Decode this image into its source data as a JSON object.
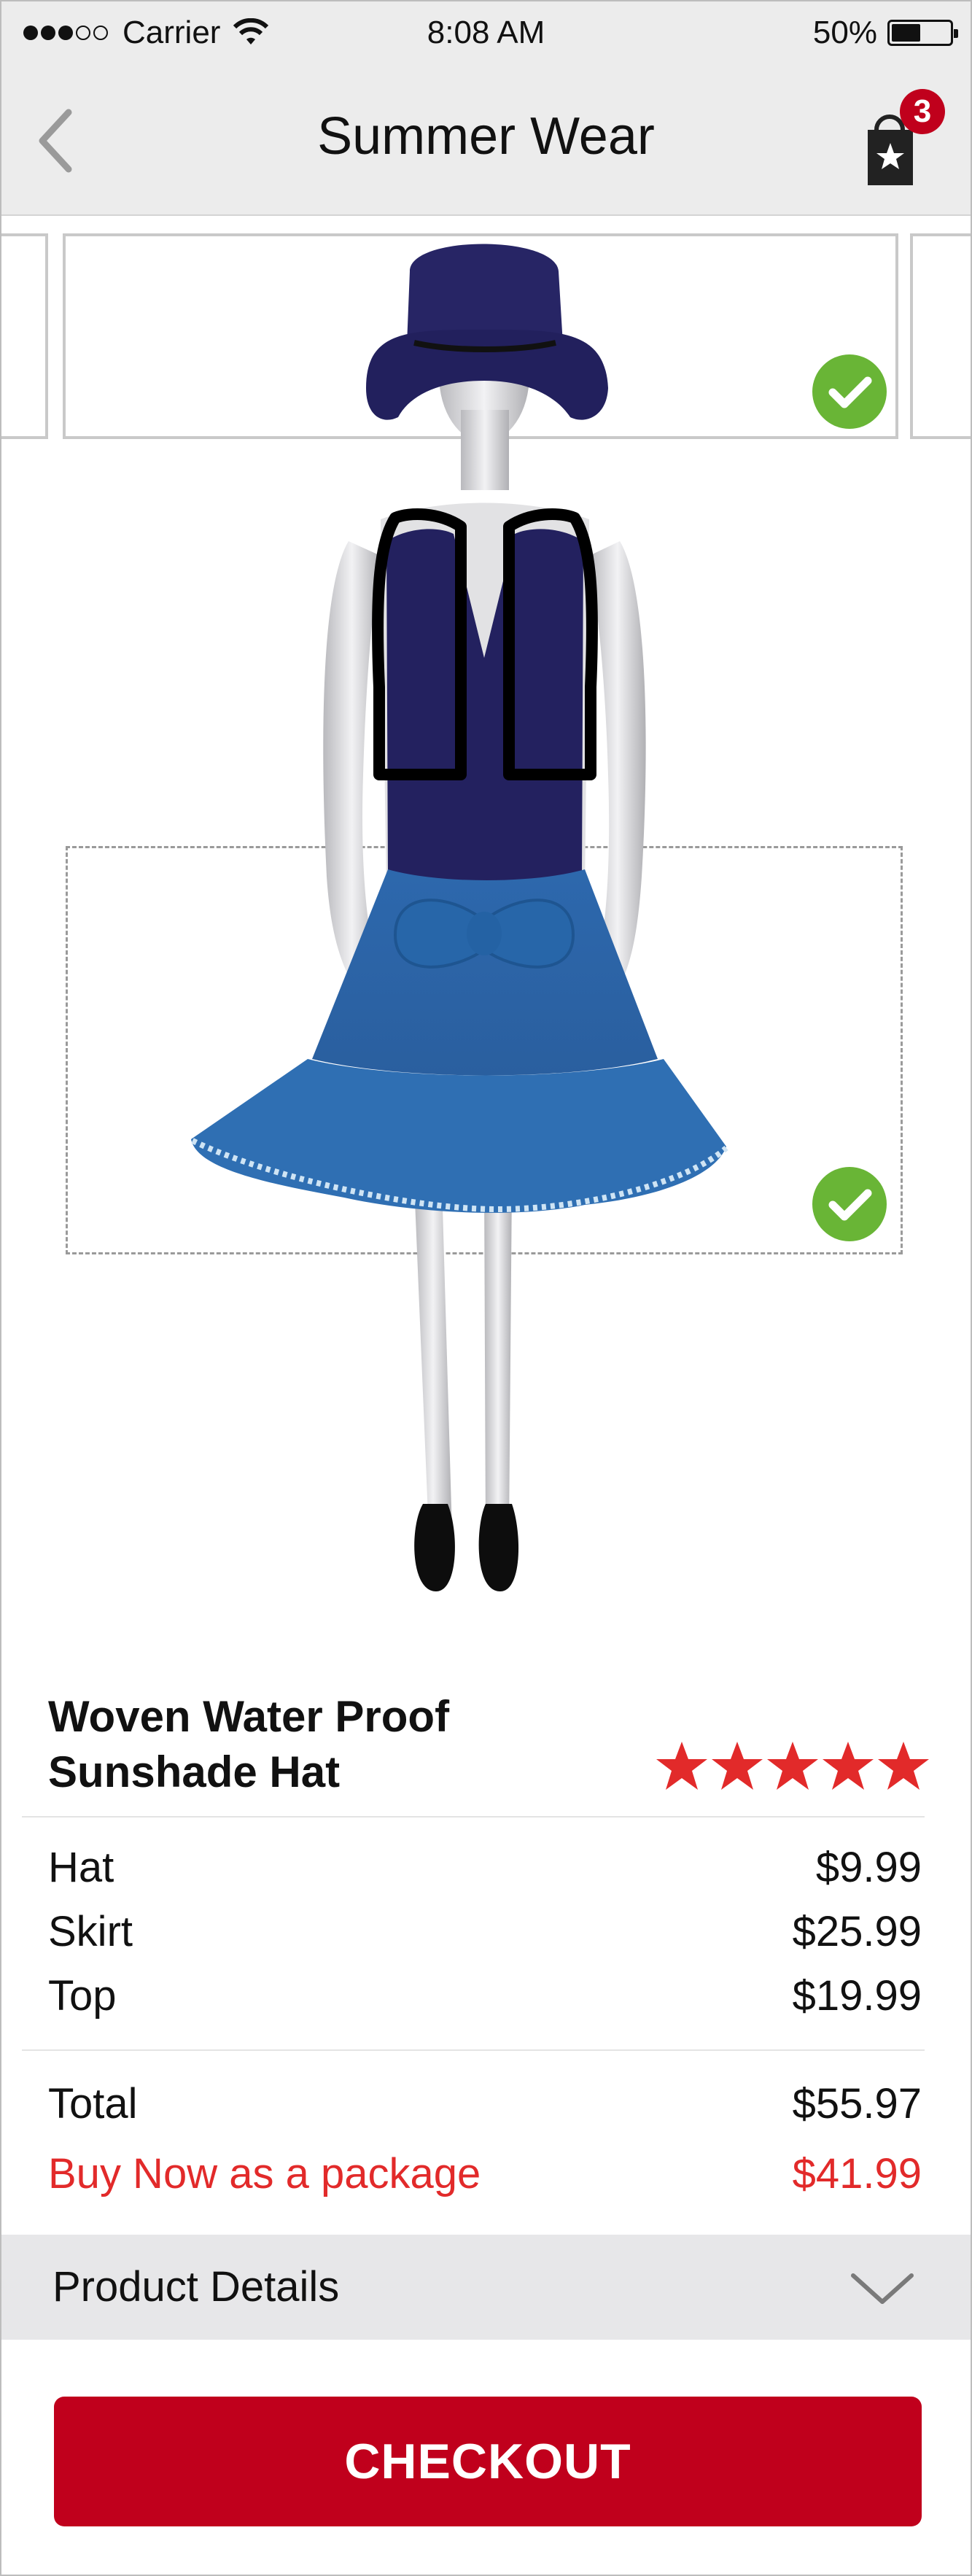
{
  "status_bar": {
    "signal_bars": 5,
    "signal_filled": 3,
    "carrier": "Carrier",
    "time": "8:08 AM",
    "battery_percent": "50%",
    "battery_level": 0.5,
    "wifi_icon": "wifi-icon"
  },
  "nav": {
    "title": "Summer Wear",
    "back_icon": "chevron-left-icon",
    "bag_icon": "shopping-bag-star-icon",
    "bag_count": "3"
  },
  "outfit": {
    "hat_selected": true,
    "skirt_selected": true
  },
  "product": {
    "name_line1": "Woven Water Proof",
    "name_line2": "Sunshade Hat",
    "rating": 5,
    "rating_max": 5
  },
  "items": [
    {
      "label": "Hat",
      "price": "$9.99"
    },
    {
      "label": "Skirt",
      "price": "$25.99"
    },
    {
      "label": "Top",
      "price": "$19.99"
    }
  ],
  "total": {
    "label": "Total",
    "price": "$55.97"
  },
  "package": {
    "label": "Buy Now as a package",
    "price": "$41.99"
  },
  "details": {
    "label": "Product Details",
    "icon": "chevron-down-icon"
  },
  "checkout": {
    "label": "CHECKOUT"
  },
  "colors": {
    "accent_red": "#c0001c",
    "price_red": "#e22a2a",
    "check_green": "#69b536",
    "star_red": "#e22a2a",
    "navy": "#23215f",
    "denim": "#2f6fb3"
  }
}
